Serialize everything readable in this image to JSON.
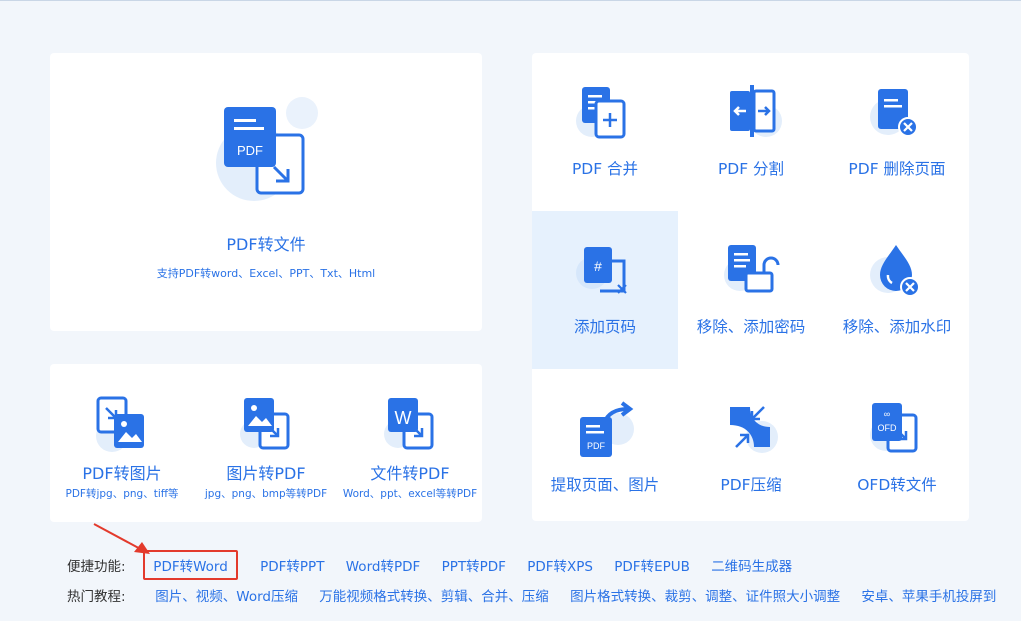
{
  "main_card": {
    "title": "PDF转文件",
    "subtitle": "支持PDF转word、Excel、PPT、Txt、Html",
    "icon_text": "PDF"
  },
  "tools": [
    {
      "title": "PDF转图片",
      "subtitle": "PDF转jpg、png、tiff等"
    },
    {
      "title": "图片转PDF",
      "subtitle": "jpg、png、bmp等转PDF"
    },
    {
      "title": "文件转PDF",
      "subtitle": "Word、ppt、excel等转PDF",
      "icon_text": "W"
    }
  ],
  "grid": [
    {
      "label": "PDF 合并"
    },
    {
      "label": "PDF 分割"
    },
    {
      "label": "PDF 删除页面"
    },
    {
      "label": "添加页码",
      "active": true
    },
    {
      "label": "移除、添加密码"
    },
    {
      "label": "移除、添加水印"
    },
    {
      "label": "提取页面、图片",
      "icon_text": "PDF"
    },
    {
      "label": "PDF压缩"
    },
    {
      "label": "OFD转文件",
      "icon_text": "OFD"
    }
  ],
  "quick": {
    "label": "便捷功能:",
    "links": [
      "PDF转Word",
      "PDF转PPT",
      "Word转PDF",
      "PPT转PDF",
      "PDF转XPS",
      "PDF转EPUB",
      "二维码生成器"
    ]
  },
  "hot": {
    "label": "热门教程:",
    "links": [
      "图片、视频、Word压缩",
      "万能视频格式转换、剪辑、合并、压缩",
      "图片格式转换、裁剪、调整、证件照大小调整",
      "安卓、苹果手机投屏到"
    ]
  },
  "colors": {
    "accent": "#2a72e6",
    "highlight": "#e33a2c",
    "active_bg": "#e6f1fd"
  }
}
